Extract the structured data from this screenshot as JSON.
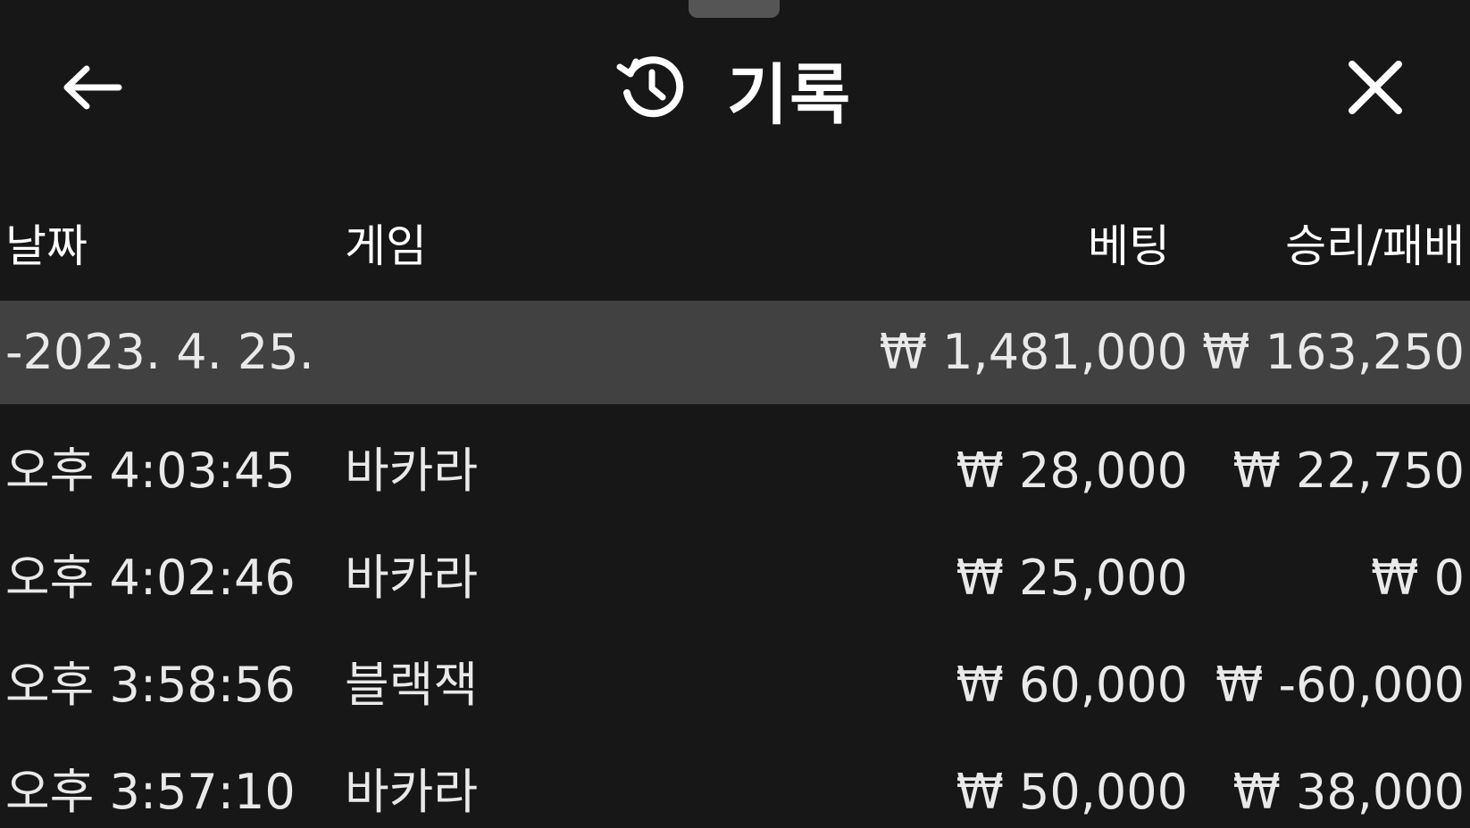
{
  "header": {
    "title": "기록",
    "back_icon": "arrow-left-icon",
    "history_icon": "history-clock-icon",
    "close_icon": "close-icon"
  },
  "columns": {
    "date": "날짜",
    "game": "게임",
    "bet": "베팅",
    "result": "승리/패배"
  },
  "group": {
    "date": "-2023. 4. 25.",
    "bet_total": "₩ 1,481,000",
    "result_total": "₩ 163,250"
  },
  "rows": [
    {
      "time": "오후 4:03:45",
      "game": "바카라",
      "bet": "₩ 28,000",
      "result": "₩ 22,750"
    },
    {
      "time": "오후 4:02:46",
      "game": "바카라",
      "bet": "₩ 25,000",
      "result": "₩ 0"
    },
    {
      "time": "오후 3:58:56",
      "game": "블랙잭",
      "bet": "₩ 60,000",
      "result": "₩ -60,000"
    },
    {
      "time": "오후 3:57:10",
      "game": "바카라",
      "bet": "₩ 50,000",
      "result": "₩ 38,000"
    }
  ],
  "colors": {
    "background": "#171717",
    "group_row": "#414141",
    "text": "#e9e9e9"
  }
}
